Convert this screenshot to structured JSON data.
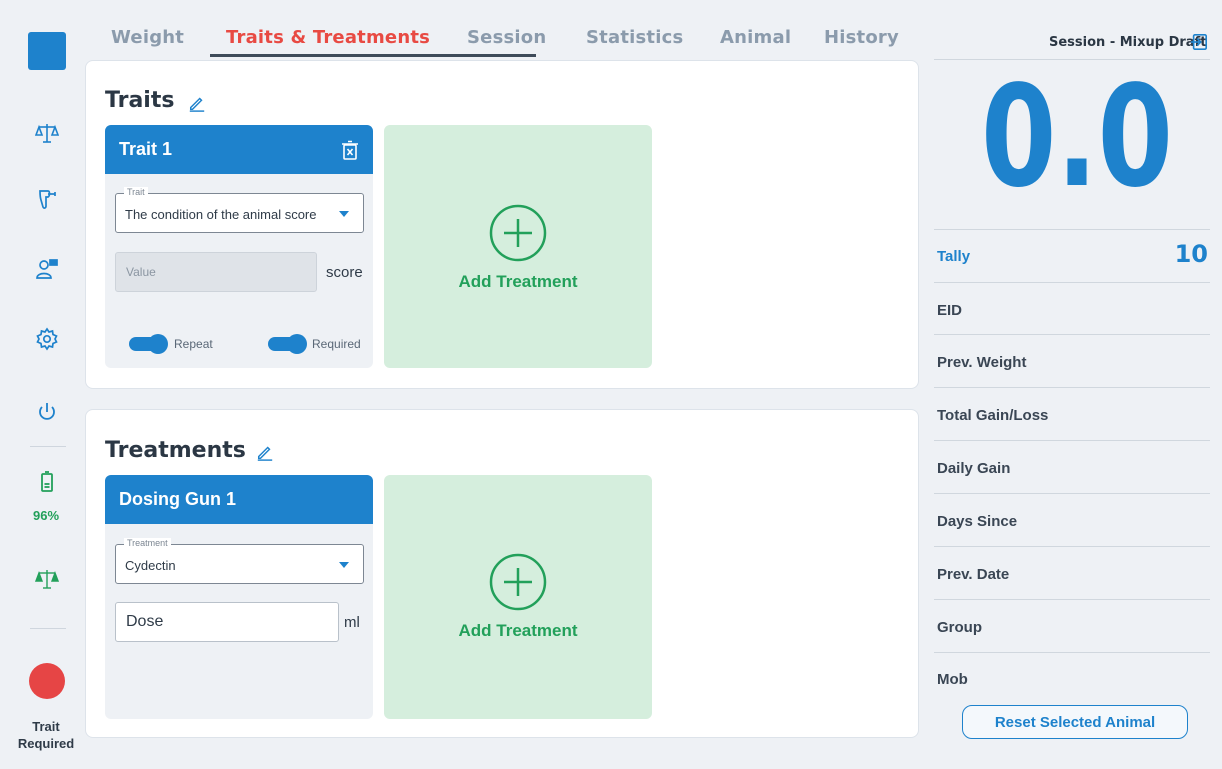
{
  "sidebar": {
    "battery_percent": "96%",
    "status_text": "Trait\nRequired"
  },
  "tabs": [
    {
      "label": "Weight",
      "active": false
    },
    {
      "label": "Traits & Treatments",
      "active": true
    },
    {
      "label": "Session",
      "active": false
    },
    {
      "label": "Statistics",
      "active": false
    },
    {
      "label": "Animal",
      "active": false
    },
    {
      "label": "History",
      "active": false
    }
  ],
  "traits": {
    "title": "Traits",
    "card": {
      "header": "Trait 1",
      "select_label": "Trait",
      "select_value": "The condition of the animal score",
      "value_placeholder": "Value",
      "unit": "score",
      "repeat_label": "Repeat",
      "required_label": "Required"
    },
    "add_label": "Add Treatment"
  },
  "treatments": {
    "title": "Treatments",
    "card": {
      "header": "Dosing Gun 1",
      "select_label": "Treatment",
      "select_value": "Cydectin",
      "dose_label": "Dose",
      "unit": "ml"
    },
    "add_label": "Add Treatment"
  },
  "right_panel": {
    "session_title": "Session - Mixup Draft",
    "weight_display": "0.0",
    "tally_label": "Tally",
    "tally_value": "10",
    "fields": [
      "EID",
      "Prev. Weight",
      "Total Gain/Loss",
      "Daily Gain",
      "Days Since",
      "Prev. Date",
      "Group",
      "Mob"
    ],
    "reset_button": "Reset Selected Animal"
  },
  "colors": {
    "accent_blue": "#1e82cc",
    "active_tab": "#e84a43",
    "add_green": "#22a05a",
    "add_bg": "#d5eedd",
    "record_red": "#e64545"
  }
}
